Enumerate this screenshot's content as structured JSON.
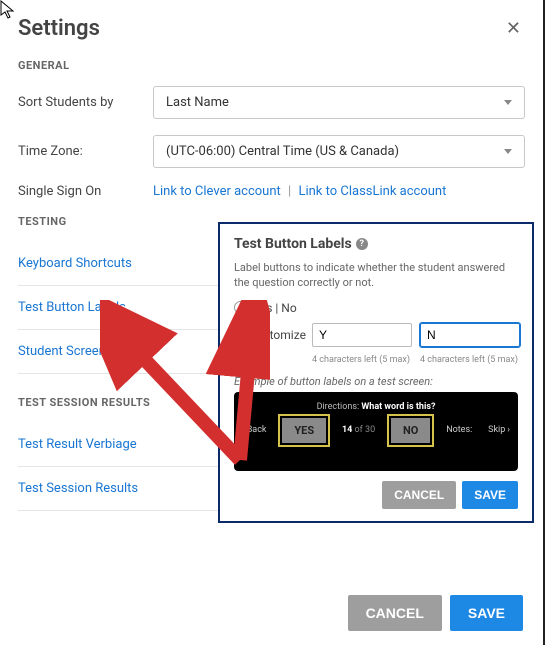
{
  "header": {
    "title": "Settings"
  },
  "general": {
    "heading": "GENERAL",
    "sort_label": "Sort Students by",
    "sort_value": "Last Name",
    "tz_label": "Time Zone:",
    "tz_value": "(UTC-06:00) Central Time (US & Canada)",
    "sso_label": "Single Sign On",
    "sso_clever": "Link to Clever account",
    "sso_classlink": "Link to ClassLink account"
  },
  "testing": {
    "heading": "TESTING",
    "items": [
      "Keyboard Shortcuts",
      "Test Button Labels",
      "Student Screen"
    ]
  },
  "results": {
    "heading": "TEST SESSION RESULTS",
    "items": [
      "Test Result Verbiage",
      "Test Session Results"
    ]
  },
  "popup": {
    "title": "Test Button Labels",
    "desc": "Label buttons to indicate whether the student answered the question correctly or not.",
    "opt_yesno": "Yes | No",
    "opt_custom": "Customize",
    "input_y": "Y",
    "input_n": "N",
    "hint_y": "4 characters left (5 max)",
    "hint_n": "4 characters left (5 max)",
    "example_label": "Example of button labels on a test screen:",
    "example": {
      "directions_label": "Directions:",
      "directions_text": "What word is this?",
      "back": "Back",
      "yes": "YES",
      "count_cur": "14",
      "count_sep": "of",
      "count_total": "30",
      "no": "NO",
      "notes": "Notes:",
      "skip": "Skip"
    },
    "cancel": "CANCEL",
    "save": "SAVE"
  },
  "footer": {
    "cancel": "CANCEL",
    "save": "SAVE"
  }
}
